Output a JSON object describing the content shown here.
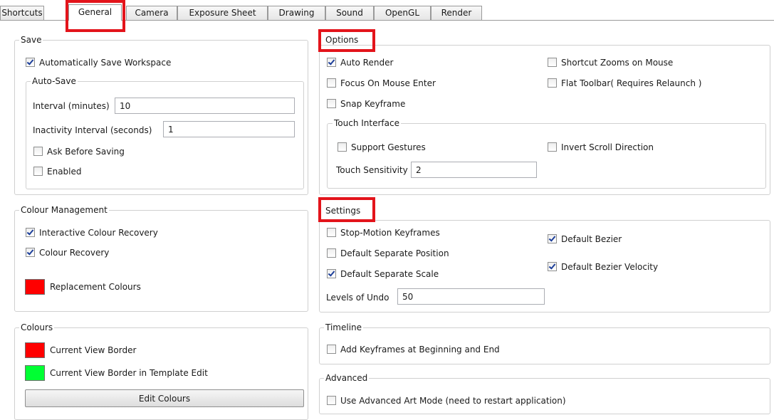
{
  "colors": {
    "highlight": "#e3141b",
    "red_swatch": "#ff0000",
    "green_swatch": "#00ff33"
  },
  "tabs": [
    {
      "label": "Shortcuts",
      "active": false
    },
    {
      "label": "General",
      "active": true
    },
    {
      "label": "Camera",
      "active": false
    },
    {
      "label": "Exposure Sheet",
      "active": false
    },
    {
      "label": "Drawing",
      "active": false
    },
    {
      "label": "Sound",
      "active": false
    },
    {
      "label": "OpenGL",
      "active": false
    },
    {
      "label": "Render",
      "active": false
    }
  ],
  "save": {
    "title": "Save",
    "auto_save_workspace": {
      "label": "Automatically Save Workspace",
      "checked": true
    },
    "auto_save": {
      "title": "Auto-Save",
      "interval_label": "Interval (minutes)",
      "interval_value": "10",
      "inactivity_label": "Inactivity Interval (seconds)",
      "inactivity_value": "1",
      "ask_before_saving": {
        "label": "Ask Before Saving",
        "checked": false
      },
      "enabled": {
        "label": "Enabled",
        "checked": false
      }
    }
  },
  "colour_management": {
    "title": "Colour Management",
    "interactive_colour_recovery": {
      "label": "Interactive Colour Recovery",
      "checked": true
    },
    "colour_recovery": {
      "label": "Colour Recovery",
      "checked": true
    },
    "replacement_colours_label": "Replacement Colours"
  },
  "colours": {
    "title": "Colours",
    "current_view_border_label": "Current View Border",
    "template_edit_border_label": "Current View Border in Template Edit",
    "edit_colours_button": "Edit Colours"
  },
  "options": {
    "title": "Options",
    "auto_render": {
      "label": "Auto Render",
      "checked": true
    },
    "focus_on_mouse_enter": {
      "label": "Focus On Mouse Enter",
      "checked": false
    },
    "snap_keyframe": {
      "label": "Snap Keyframe",
      "checked": false
    },
    "shortcut_zooms_on_mouse": {
      "label": "Shortcut Zooms on Mouse",
      "checked": false
    },
    "flat_toolbar": {
      "label": "Flat Toolbar( Requires Relaunch )",
      "checked": false
    },
    "touch_interface": {
      "title": "Touch Interface",
      "support_gestures": {
        "label": "Support Gestures",
        "checked": false
      },
      "invert_scroll_direction": {
        "label": "Invert Scroll Direction",
        "checked": false
      },
      "touch_sensitivity_label": "Touch Sensitivity",
      "touch_sensitivity_value": "2"
    }
  },
  "settings": {
    "title": "Settings",
    "stop_motion_keyframes": {
      "label": "Stop-Motion Keyframes",
      "checked": false
    },
    "default_separate_position": {
      "label": "Default Separate Position",
      "checked": false
    },
    "default_separate_scale": {
      "label": "Default Separate Scale",
      "checked": true
    },
    "default_bezier": {
      "label": "Default Bezier",
      "checked": true
    },
    "default_bezier_velocity": {
      "label": "Default Bezier Velocity",
      "checked": true
    },
    "levels_of_undo_label": "Levels of Undo",
    "levels_of_undo_value": "50"
  },
  "timeline": {
    "title": "Timeline",
    "add_keyframes": {
      "label": "Add Keyframes at Beginning and End",
      "checked": false
    }
  },
  "advanced": {
    "title": "Advanced",
    "use_advanced_art_mode": {
      "label": "Use Advanced Art Mode (need to restart application)",
      "checked": false
    }
  }
}
